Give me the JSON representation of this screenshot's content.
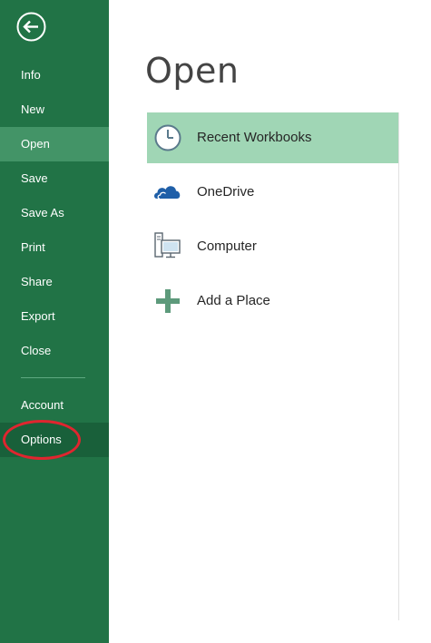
{
  "title": "Open",
  "colors": {
    "sidebar_bg": "#217346",
    "sidebar_active": "#439467",
    "sidebar_hover": "#19603a",
    "selected_location_bg": "#a0d6b5",
    "annotation_ring": "#e0252f"
  },
  "sidebar": {
    "back_icon": "back-arrow-icon",
    "items": [
      {
        "label": "Info"
      },
      {
        "label": "New"
      },
      {
        "label": "Open"
      },
      {
        "label": "Save"
      },
      {
        "label": "Save As"
      },
      {
        "label": "Print"
      },
      {
        "label": "Share"
      },
      {
        "label": "Export"
      },
      {
        "label": "Close"
      },
      {
        "label": "Account"
      },
      {
        "label": "Options"
      }
    ],
    "active_item": "Open",
    "hovered_item": "Options"
  },
  "locations": [
    {
      "label": "Recent Workbooks",
      "icon": "clock-icon",
      "selected": true
    },
    {
      "label": "OneDrive",
      "icon": "cloud-icon",
      "selected": false
    },
    {
      "label": "Computer",
      "icon": "computer-icon",
      "selected": false
    },
    {
      "label": "Add a Place",
      "icon": "plus-icon",
      "selected": false
    }
  ]
}
